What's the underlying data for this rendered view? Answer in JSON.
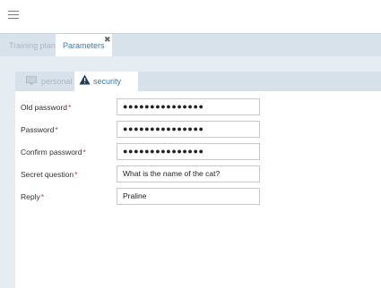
{
  "header": {
    "menu_icon": "hamburger-menu-icon"
  },
  "tabs": [
    {
      "label": "Training plan",
      "active": false
    },
    {
      "label": "Parameters",
      "active": true,
      "close": "✖"
    }
  ],
  "subtabs": [
    {
      "label": "personal",
      "icon": "monitor-icon",
      "active": false
    },
    {
      "label": "security",
      "icon": "warning-icon",
      "active": true
    }
  ],
  "form": {
    "fields": [
      {
        "label": "Old password",
        "value": "●●●●●●●●●●●●●●●",
        "required_mark": "*"
      },
      {
        "label": "Password",
        "value": "●●●●●●●●●●●●●●●",
        "required_mark": "*"
      },
      {
        "label": "Confirm password",
        "value": "●●●●●●●●●●●●●●●",
        "required_mark": "*"
      },
      {
        "label": "Secret question",
        "value": "What is the name of the cat?",
        "required_mark": "*"
      },
      {
        "label": "Reply",
        "value": "Praline",
        "required_mark": "*"
      }
    ]
  },
  "colors": {
    "accent": "#2d7fc1",
    "tabbar": "#d8e2ea",
    "required": "#d93030"
  }
}
